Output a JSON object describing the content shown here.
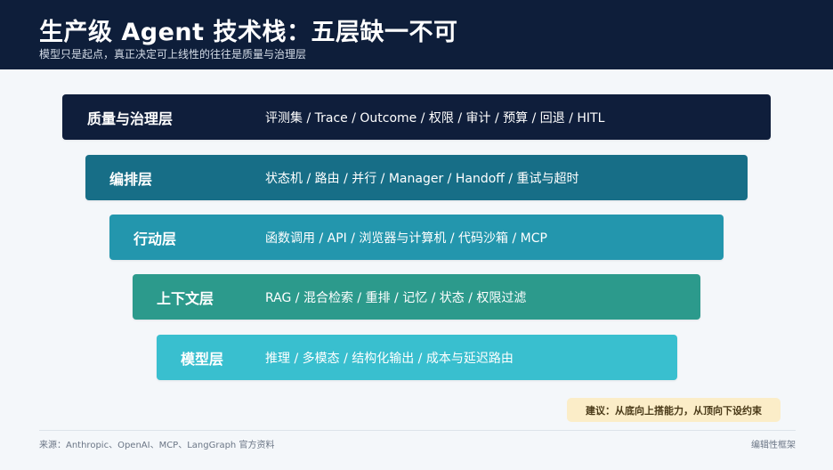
{
  "header": {
    "title": "生产级 Agent 技术栈：五层缺一不可",
    "subtitle": "模型只是起点，真正决定可上线性的往往是质量与治理层"
  },
  "layers": [
    {
      "name": "质量与治理层",
      "items": "评测集 / Trace / Outcome / 权限 / 审计 / 预算 / 回退 / HITL",
      "color": "#0f1e3b"
    },
    {
      "name": "编排层",
      "items": "状态机 / 路由 / 并行 / Manager / Handoff / 重试与超时",
      "color": "#176e87"
    },
    {
      "name": "行动层",
      "items": "函数调用 / API / 浏览器与计算机 / 代码沙箱 / MCP",
      "color": "#2396ad"
    },
    {
      "name": "上下文层",
      "items": "RAG / 混合检索 / 重排 / 记忆 / 状态 / 权限过滤",
      "color": "#2c9a8c"
    },
    {
      "name": "模型层",
      "items": "推理 / 多模态 / 结构化输出 / 成本与延迟路由",
      "color": "#39bfcf"
    }
  ],
  "advice": "建议：从底向上搭能力，从顶向下设约束",
  "footer": {
    "source": "来源：Anthropic、OpenAI、MCP、LangGraph 官方资料",
    "framework": "编辑性框架"
  }
}
